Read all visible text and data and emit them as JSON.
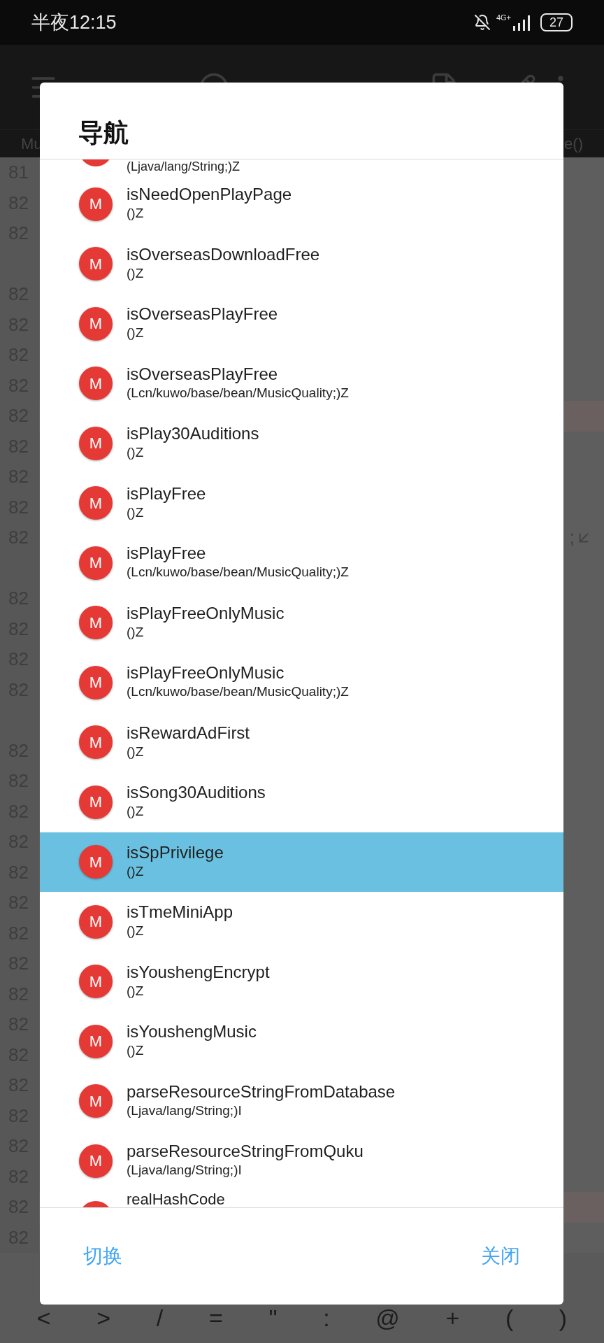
{
  "status_bar": {
    "time": "半夜12:15",
    "network": "4G+",
    "battery": "27"
  },
  "editor": {
    "tabs": [
      {
        "label": "Mu"
      },
      {
        "label": "e()"
      }
    ],
    "lines": [
      {
        "kind": "number",
        "text": "81",
        "highlighted": false
      },
      {
        "kind": "number",
        "text": "82",
        "highlighted": false
      },
      {
        "kind": "number",
        "text": "82",
        "highlighted": false
      },
      {
        "kind": "wrap"
      },
      {
        "kind": "number",
        "text": "82",
        "highlighted": false
      },
      {
        "kind": "number",
        "text": "82",
        "highlighted": false
      },
      {
        "kind": "number",
        "text": "82",
        "highlighted": false
      },
      {
        "kind": "number",
        "text": "82",
        "highlighted": false
      },
      {
        "kind": "number",
        "text": "82",
        "highlighted": true
      },
      {
        "kind": "number",
        "text": "82",
        "highlighted": false
      },
      {
        "kind": "number",
        "text": "82",
        "highlighted": false
      },
      {
        "kind": "number",
        "text": "82",
        "highlighted": false
      },
      {
        "kind": "number",
        "text": "82",
        "highlighted": false,
        "tail": ";"
      },
      {
        "kind": "wrap"
      },
      {
        "kind": "number",
        "text": "82",
        "highlighted": false
      },
      {
        "kind": "number",
        "text": "82",
        "highlighted": false
      },
      {
        "kind": "number",
        "text": "82",
        "highlighted": false
      },
      {
        "kind": "number",
        "text": "82",
        "highlighted": false
      },
      {
        "kind": "wrap"
      },
      {
        "kind": "number",
        "text": "82",
        "highlighted": false
      },
      {
        "kind": "number",
        "text": "82",
        "highlighted": false
      },
      {
        "kind": "number",
        "text": "82",
        "highlighted": false
      },
      {
        "kind": "number",
        "text": "82",
        "highlighted": false
      },
      {
        "kind": "number",
        "text": "82",
        "highlighted": false
      },
      {
        "kind": "number",
        "text": "82",
        "highlighted": false
      },
      {
        "kind": "number",
        "text": "82",
        "highlighted": false
      },
      {
        "kind": "number",
        "text": "82",
        "highlighted": false
      },
      {
        "kind": "number",
        "text": "82",
        "highlighted": false
      },
      {
        "kind": "number",
        "text": "82",
        "highlighted": false
      },
      {
        "kind": "number",
        "text": "82",
        "highlighted": false
      },
      {
        "kind": "number",
        "text": "82",
        "highlighted": false
      },
      {
        "kind": "number",
        "text": "82",
        "highlighted": false
      },
      {
        "kind": "number",
        "text": "82",
        "highlighted": false
      },
      {
        "kind": "number",
        "text": "82",
        "highlighted": false
      },
      {
        "kind": "number",
        "text": "82",
        "highlighted": true
      },
      {
        "kind": "number",
        "text": "82",
        "highlighted": false
      }
    ]
  },
  "symbol_bar": [
    "<",
    ">",
    "/",
    "=",
    "\"",
    ":",
    "@",
    "+",
    "(",
    ")"
  ],
  "dialog": {
    "title": "导航",
    "items": [
      {
        "kind": "partial",
        "signature": "(Ljava/lang/String;)Z",
        "selected": false
      },
      {
        "badge": "M",
        "name": "isNeedOpenPlayPage",
        "signature": "()Z",
        "selected": false
      },
      {
        "badge": "M",
        "name": "isOverseasDownloadFree",
        "signature": "()Z",
        "selected": false
      },
      {
        "badge": "M",
        "name": "isOverseasPlayFree",
        "signature": "()Z",
        "selected": false
      },
      {
        "badge": "M",
        "name": "isOverseasPlayFree",
        "signature": "(Lcn/kuwo/base/bean/MusicQuality;)Z",
        "selected": false
      },
      {
        "badge": "M",
        "name": "isPlay30Auditions",
        "signature": "()Z",
        "selected": false
      },
      {
        "badge": "M",
        "name": "isPlayFree",
        "signature": "()Z",
        "selected": false
      },
      {
        "badge": "M",
        "name": "isPlayFree",
        "signature": "(Lcn/kuwo/base/bean/MusicQuality;)Z",
        "selected": false
      },
      {
        "badge": "M",
        "name": "isPlayFreeOnlyMusic",
        "signature": "()Z",
        "selected": false
      },
      {
        "badge": "M",
        "name": "isPlayFreeOnlyMusic",
        "signature": "(Lcn/kuwo/base/bean/MusicQuality;)Z",
        "selected": false
      },
      {
        "badge": "M",
        "name": "isRewardAdFirst",
        "signature": "()Z",
        "selected": false
      },
      {
        "badge": "M",
        "name": "isSong30Auditions",
        "signature": "()Z",
        "selected": false
      },
      {
        "badge": "M",
        "name": "isSpPrivilege",
        "signature": "()Z",
        "selected": true
      },
      {
        "badge": "M",
        "name": "isTmeMiniApp",
        "signature": "()Z",
        "selected": false
      },
      {
        "badge": "M",
        "name": "isYoushengEncrypt",
        "signature": "()Z",
        "selected": false
      },
      {
        "badge": "M",
        "name": "isYoushengMusic",
        "signature": "()Z",
        "selected": false
      },
      {
        "badge": "M",
        "name": "parseResourceStringFromDatabase",
        "signature": "(Ljava/lang/String;)I",
        "selected": false
      },
      {
        "badge": "M",
        "name": "parseResourceStringFromQuku",
        "signature": "(Ljava/lang/String;)I",
        "selected": false
      },
      {
        "kind": "partial",
        "name": "realHashCode",
        "selected": false
      }
    ],
    "buttons": [
      {
        "label": "切换"
      },
      {
        "label": "关闭"
      }
    ]
  }
}
